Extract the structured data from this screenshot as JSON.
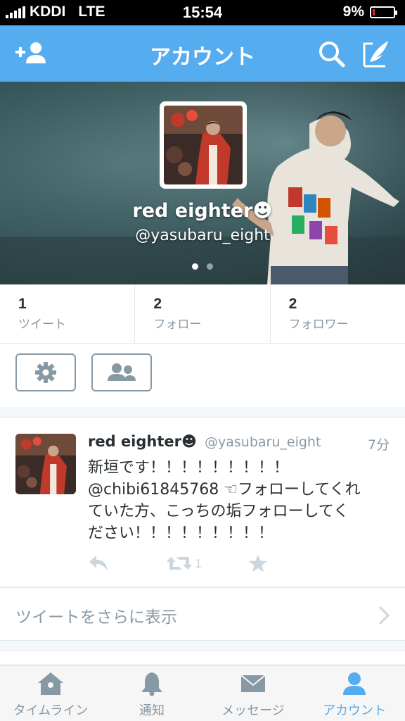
{
  "status_bar": {
    "carrier": "KDDI",
    "network": "LTE",
    "time": "15:54",
    "battery": "9%",
    "battery_level": 0.09,
    "battery_color": "#e0282c"
  },
  "nav": {
    "title": "アカウント",
    "left_icon": "add-user-icon",
    "right_icons": [
      "search-icon",
      "compose-icon"
    ],
    "color": "#55acee"
  },
  "profile": {
    "name": "red eighter☻",
    "handle": "@yasubaru_eight",
    "page_dots": 2,
    "active_dot": 0
  },
  "stats": [
    {
      "value": "1",
      "label": "ツイート"
    },
    {
      "value": "2",
      "label": "フォロー"
    },
    {
      "value": "2",
      "label": "フォロワー"
    }
  ],
  "action_buttons": [
    "gear-icon",
    "people-icon"
  ],
  "tweet": {
    "name": "red eighter☻",
    "handle": "@yasubaru_eight",
    "time": "7分",
    "lines": [
      "新垣です！！！！！！！！！",
      "@chibi61845768 ☜フォローしてくれ",
      "ていた方、こっちの垢フォローしてく",
      "ださい！！！！！！！！！"
    ],
    "retweet_count": "1"
  },
  "more_tweets": {
    "label": "ツイートをさらに表示"
  },
  "tab_bar": [
    {
      "label": "タイムライン",
      "icon": "home-icon",
      "active": false
    },
    {
      "label": "通知",
      "icon": "bell-icon",
      "active": false
    },
    {
      "label": "メッセージ",
      "icon": "envelope-icon",
      "active": false
    },
    {
      "label": "アカウント",
      "icon": "person-icon",
      "active": true
    }
  ]
}
